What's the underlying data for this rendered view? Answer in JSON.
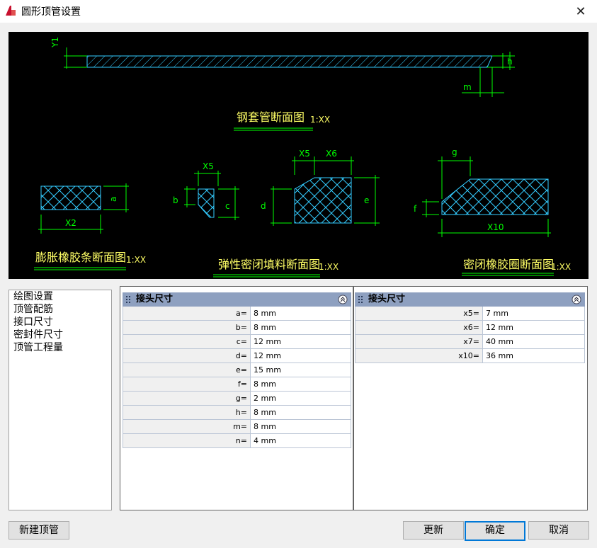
{
  "window": {
    "title": "圆形顶管设置",
    "close_glyph": "✕"
  },
  "drawing": {
    "steel_label": "钢套管断面图",
    "scale": "1:XX",
    "rubber_strip_label": "膨胀橡胶条断面图",
    "filler_label": "弹性密闭填料断面图",
    "seal_ring_label": "密闭橡胶圈断面图",
    "dims": {
      "y1": "Y1",
      "h": "h",
      "m": "m",
      "a": "a",
      "x2": "X2",
      "x5": "X5",
      "x6": "X6",
      "b": "b",
      "c": "c",
      "d": "d",
      "e": "e",
      "g": "g",
      "f": "f",
      "x10": "X10"
    }
  },
  "tree": {
    "items": [
      "绘图设置",
      "顶管配筋",
      "接口尺寸",
      "密封件尺寸",
      "顶管工程量"
    ]
  },
  "left_group": {
    "title": "接头尺寸",
    "rows": [
      {
        "k": "a=",
        "v": "8 mm"
      },
      {
        "k": "b=",
        "v": "8 mm"
      },
      {
        "k": "c=",
        "v": "12 mm"
      },
      {
        "k": "d=",
        "v": "12 mm"
      },
      {
        "k": "e=",
        "v": "15 mm"
      },
      {
        "k": "f=",
        "v": "8 mm"
      },
      {
        "k": "g=",
        "v": "2 mm"
      },
      {
        "k": "h=",
        "v": "8 mm"
      },
      {
        "k": "m=",
        "v": "8 mm"
      },
      {
        "k": "n=",
        "v": "4 mm"
      }
    ]
  },
  "right_group": {
    "title": "接头尺寸",
    "rows": [
      {
        "k": "x5=",
        "v": "7 mm"
      },
      {
        "k": "x6=",
        "v": "12 mm"
      },
      {
        "k": "x7=",
        "v": "40 mm"
      },
      {
        "k": "x10=",
        "v": "36 mm"
      }
    ]
  },
  "buttons": {
    "new_pipe": "新建顶管",
    "update": "更新",
    "ok": "确定",
    "cancel": "取消"
  },
  "colors": {
    "dim": "#00ff00",
    "label": "#ffff66",
    "hatch": "#33ccff"
  }
}
